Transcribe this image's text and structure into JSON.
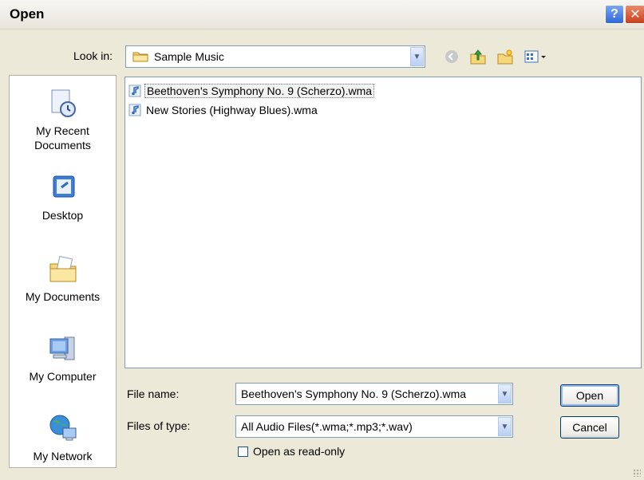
{
  "window": {
    "title": "Open"
  },
  "lookin": {
    "label": "Look in:",
    "value": "Sample Music"
  },
  "places": [
    {
      "label_line1": "My Recent",
      "label_line2": "Documents"
    },
    {
      "label_line1": "Desktop",
      "label_line2": ""
    },
    {
      "label_line1": "My Documents",
      "label_line2": ""
    },
    {
      "label_line1": "My Computer",
      "label_line2": ""
    },
    {
      "label_line1": "My Network",
      "label_line2": ""
    }
  ],
  "files": [
    {
      "name": "Beethoven's Symphony No. 9 (Scherzo).wma",
      "selected": true
    },
    {
      "name": "New Stories (Highway Blues).wma",
      "selected": false
    }
  ],
  "filename": {
    "label": "File name:",
    "value": "Beethoven's Symphony No. 9 (Scherzo).wma"
  },
  "filetype": {
    "label": "Files of type:",
    "value": "All Audio Files(*.wma;*.mp3;*.wav)"
  },
  "buttons": {
    "open": "Open",
    "cancel": "Cancel"
  },
  "readonly": {
    "label": "Open as read-only",
    "checked": false
  },
  "icons": {
    "help": "help-icon",
    "close": "close-icon",
    "back": "back-icon",
    "up": "up-folder-icon",
    "newfolder": "new-folder-icon",
    "views": "views-menu-icon"
  }
}
